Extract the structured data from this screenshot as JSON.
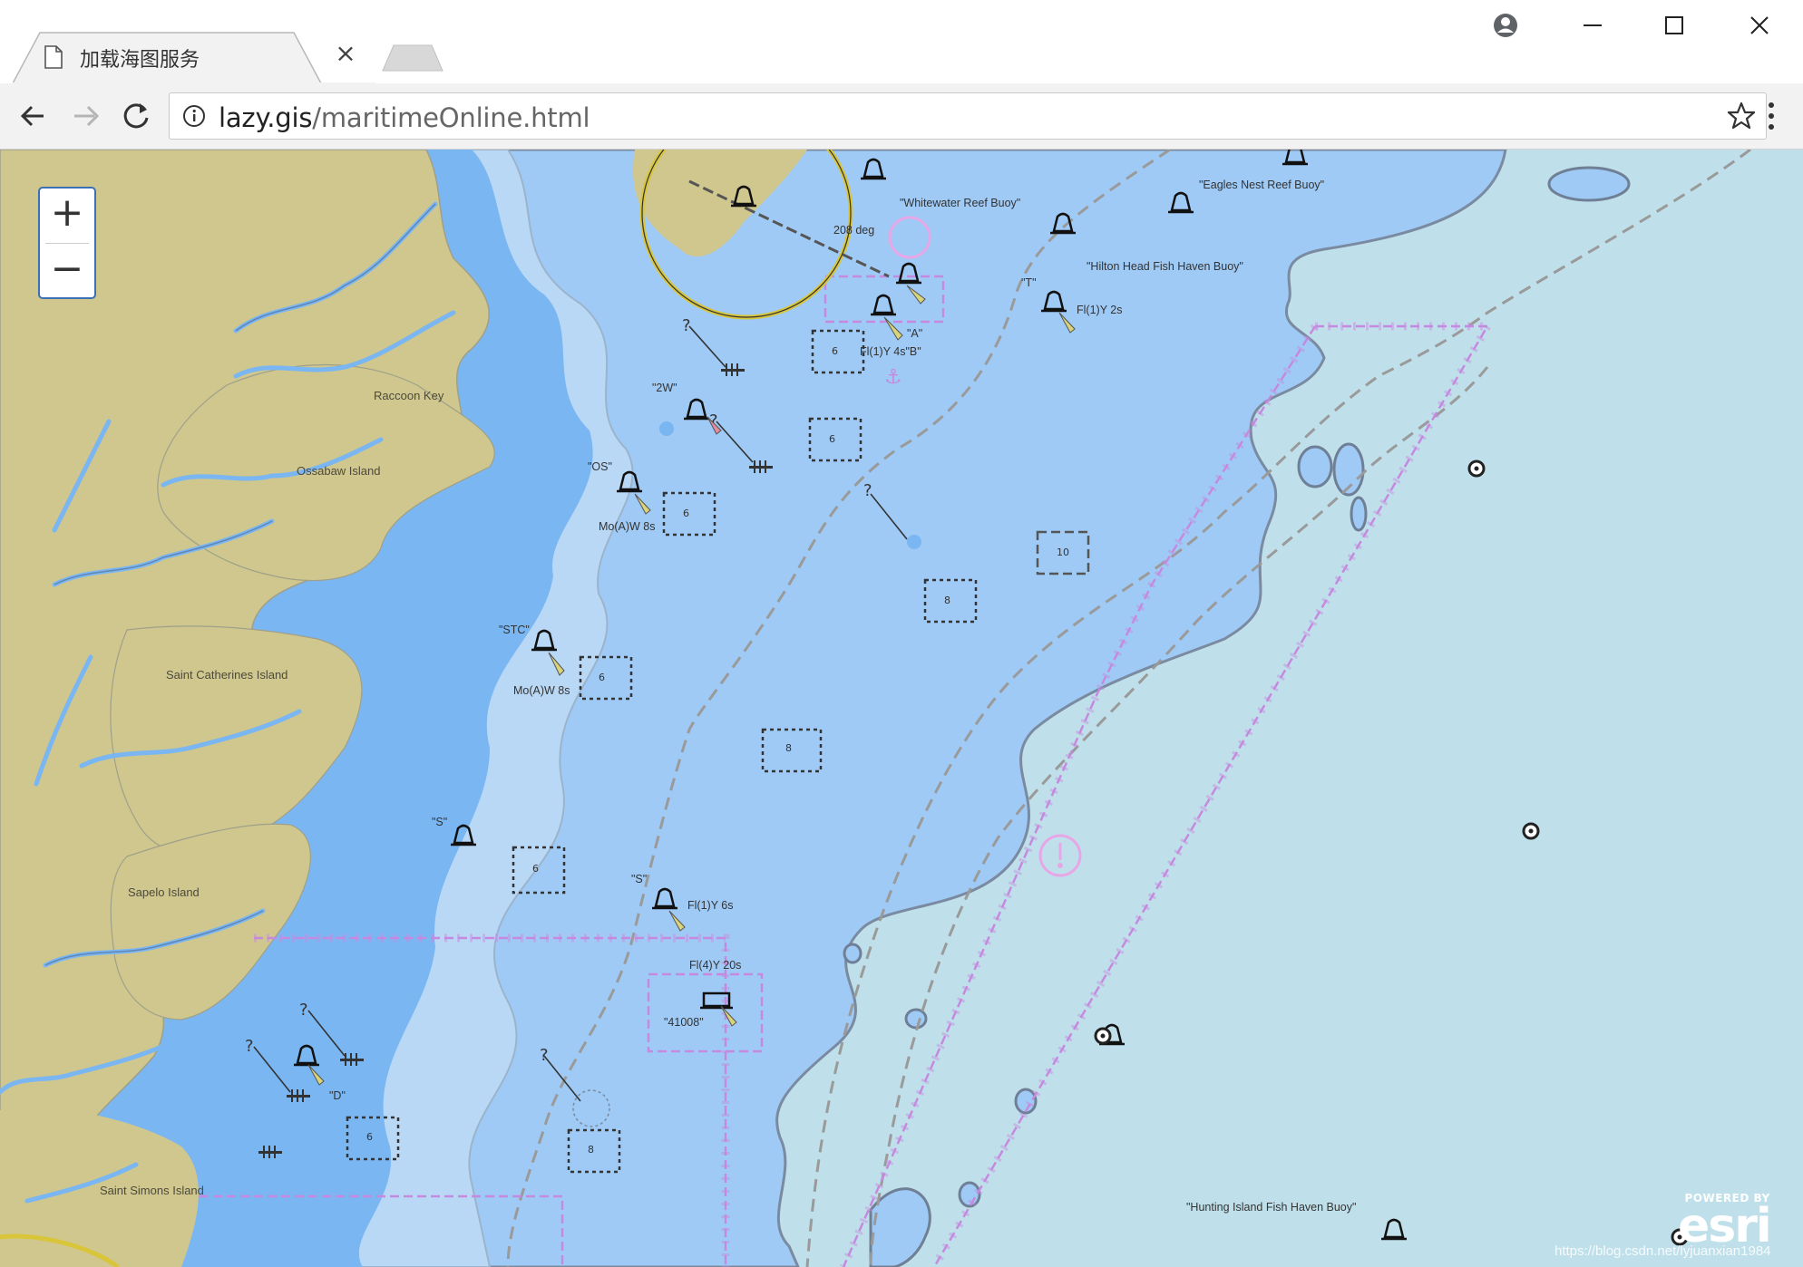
{
  "browser": {
    "tab_title": "加载海图服务",
    "tab_close": "×",
    "url_host": "lazy.gis",
    "url_path": "/maritimeOnline.html",
    "icons": [
      "page-icon",
      "account-icon",
      "minimize-icon",
      "maximize-icon",
      "close-icon",
      "back-arrow-icon",
      "forward-arrow-icon",
      "reload-icon",
      "info-icon",
      "star-icon",
      "menu-icon"
    ]
  },
  "map": {
    "zoom_in": "+",
    "zoom_out": "−",
    "colors": {
      "land": "#cfc78e",
      "deep": "#9fc9f5",
      "shallow": "#7ab6f2",
      "offshore": "#bfe0ea",
      "restricted": "#c58ae0"
    },
    "land_labels": [
      "Raccoon Key",
      "Ossabaw Island",
      "Saint Catherines Island",
      "Sapelo Island",
      "Saint Simons Island"
    ],
    "buoy_labels": [
      "\"Whitewater Reef Buoy\"",
      "\"Eagles Nest Reef Buoy\"",
      "\"Hilton Head Fish Haven Buoy\"",
      "\"T\"",
      "Fl(1)Y 2s",
      "\"A\"",
      "Fl(1)Y 4s\"B\"",
      "208 deg",
      "\"2W\"",
      "\"OS\"",
      "Mo(A)W 8s",
      "\"STC\"",
      "Mo(A)W 8s",
      "\"S\"",
      "\"S\"",
      "Fl(1)Y 6s",
      "Fl(4)Y 20s",
      "\"41008\"",
      "\"D\"",
      "\"Hunting Island Fish Haven Buoy\""
    ],
    "soundings": [
      "6",
      "6",
      "6",
      "6",
      "8",
      "8",
      "10",
      "6",
      "6",
      "8"
    ],
    "attribution_top": "POWERED BY",
    "attribution_logo": "esri",
    "watermark": "https://blog.csdn.net/lyjuanxian1984"
  }
}
